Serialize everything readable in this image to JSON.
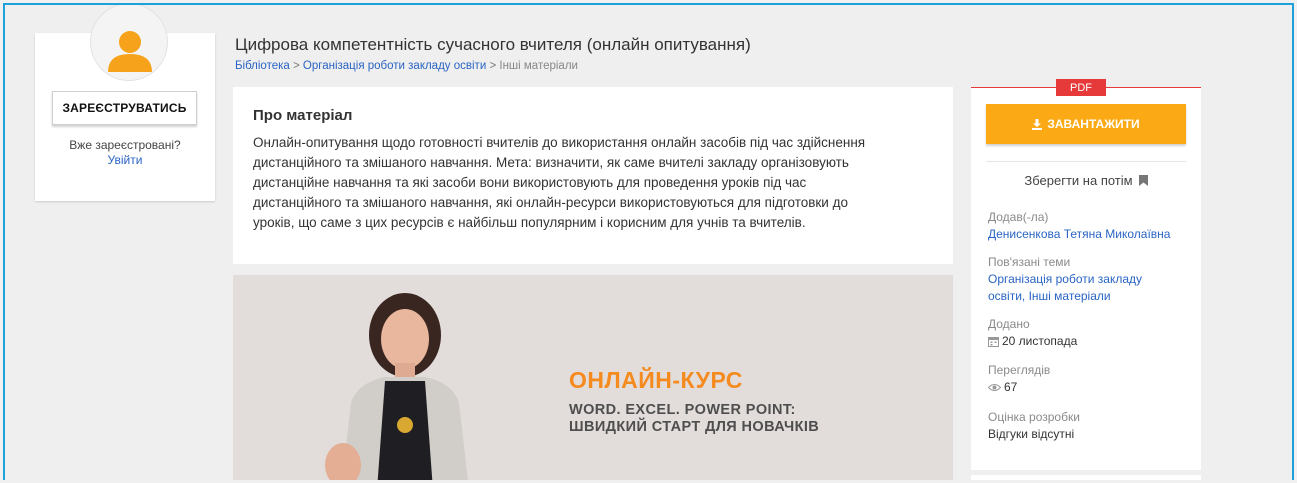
{
  "user_panel": {
    "register_label": "ЗАРЕЄСТРУВАТИСЬ",
    "already_text": "Вже зареєстровані?",
    "login_label": "Увійти"
  },
  "page": {
    "title": "Цифрова компетентність сучасного вчителя (онлайн опитування)",
    "breadcrumb": [
      "Бібліотека",
      "Організація роботи закладу освіти",
      "Інші матеріали"
    ],
    "breadcrumb_sep": ">"
  },
  "about": {
    "title": "Про матеріал",
    "lines": [
      "Онлайн-опитування щодо готовності вчителів до використання онлайн засобів під час здійснення",
      "дистанційного та змішаного навчання. Мета: визначити, як саме вчителі закладу організовують",
      "дистанційне навчання та які засоби вони використовують для проведення уроків під час",
      "дистанційного та змішаного навчання, які онлайн-ресурси використовуються для підготовки до",
      "уроків, що саме з цих ресурсів є найбільш популярним і корисним для учнів та вчителів."
    ]
  },
  "video": {
    "title": "ОНЛАЙН-КУРС",
    "subtitle_1": "WORD. EXCEL. POWER POINT:",
    "subtitle_2": "ШВИДКИЙ СТАРТ ДЛЯ НОВАЧКІВ"
  },
  "sidebar": {
    "badge": "PDF",
    "download_label": "ЗАВАНТАЖИТИ",
    "save_later": "Зберегти на потім",
    "author_label": "Додав(-ла)",
    "author_name": "Денисенкова Тетяна Миколаївна",
    "topics_label": "Пов'язані теми",
    "topic_1": "Організація роботи закладу",
    "topic_2": "освіти, Інші матеріали",
    "added_label": "Додано",
    "added_date": "20 листопада",
    "views_label": "Переглядів",
    "views_count": "67",
    "rating_label": "Оцінка розробки",
    "rating_value": "Відгуки відсутні"
  },
  "colors": {
    "accent_blue": "#1da1d8",
    "link": "#2a64c4",
    "download_orange": "#fbaa16",
    "pdf_red": "#e63a3a",
    "course_orange": "#f58a1f"
  },
  "icons": {
    "avatar": "user-avatar-icon",
    "download": "download-icon",
    "bookmark": "bookmark-icon",
    "calendar": "calendar-icon",
    "eye": "eye-icon"
  }
}
